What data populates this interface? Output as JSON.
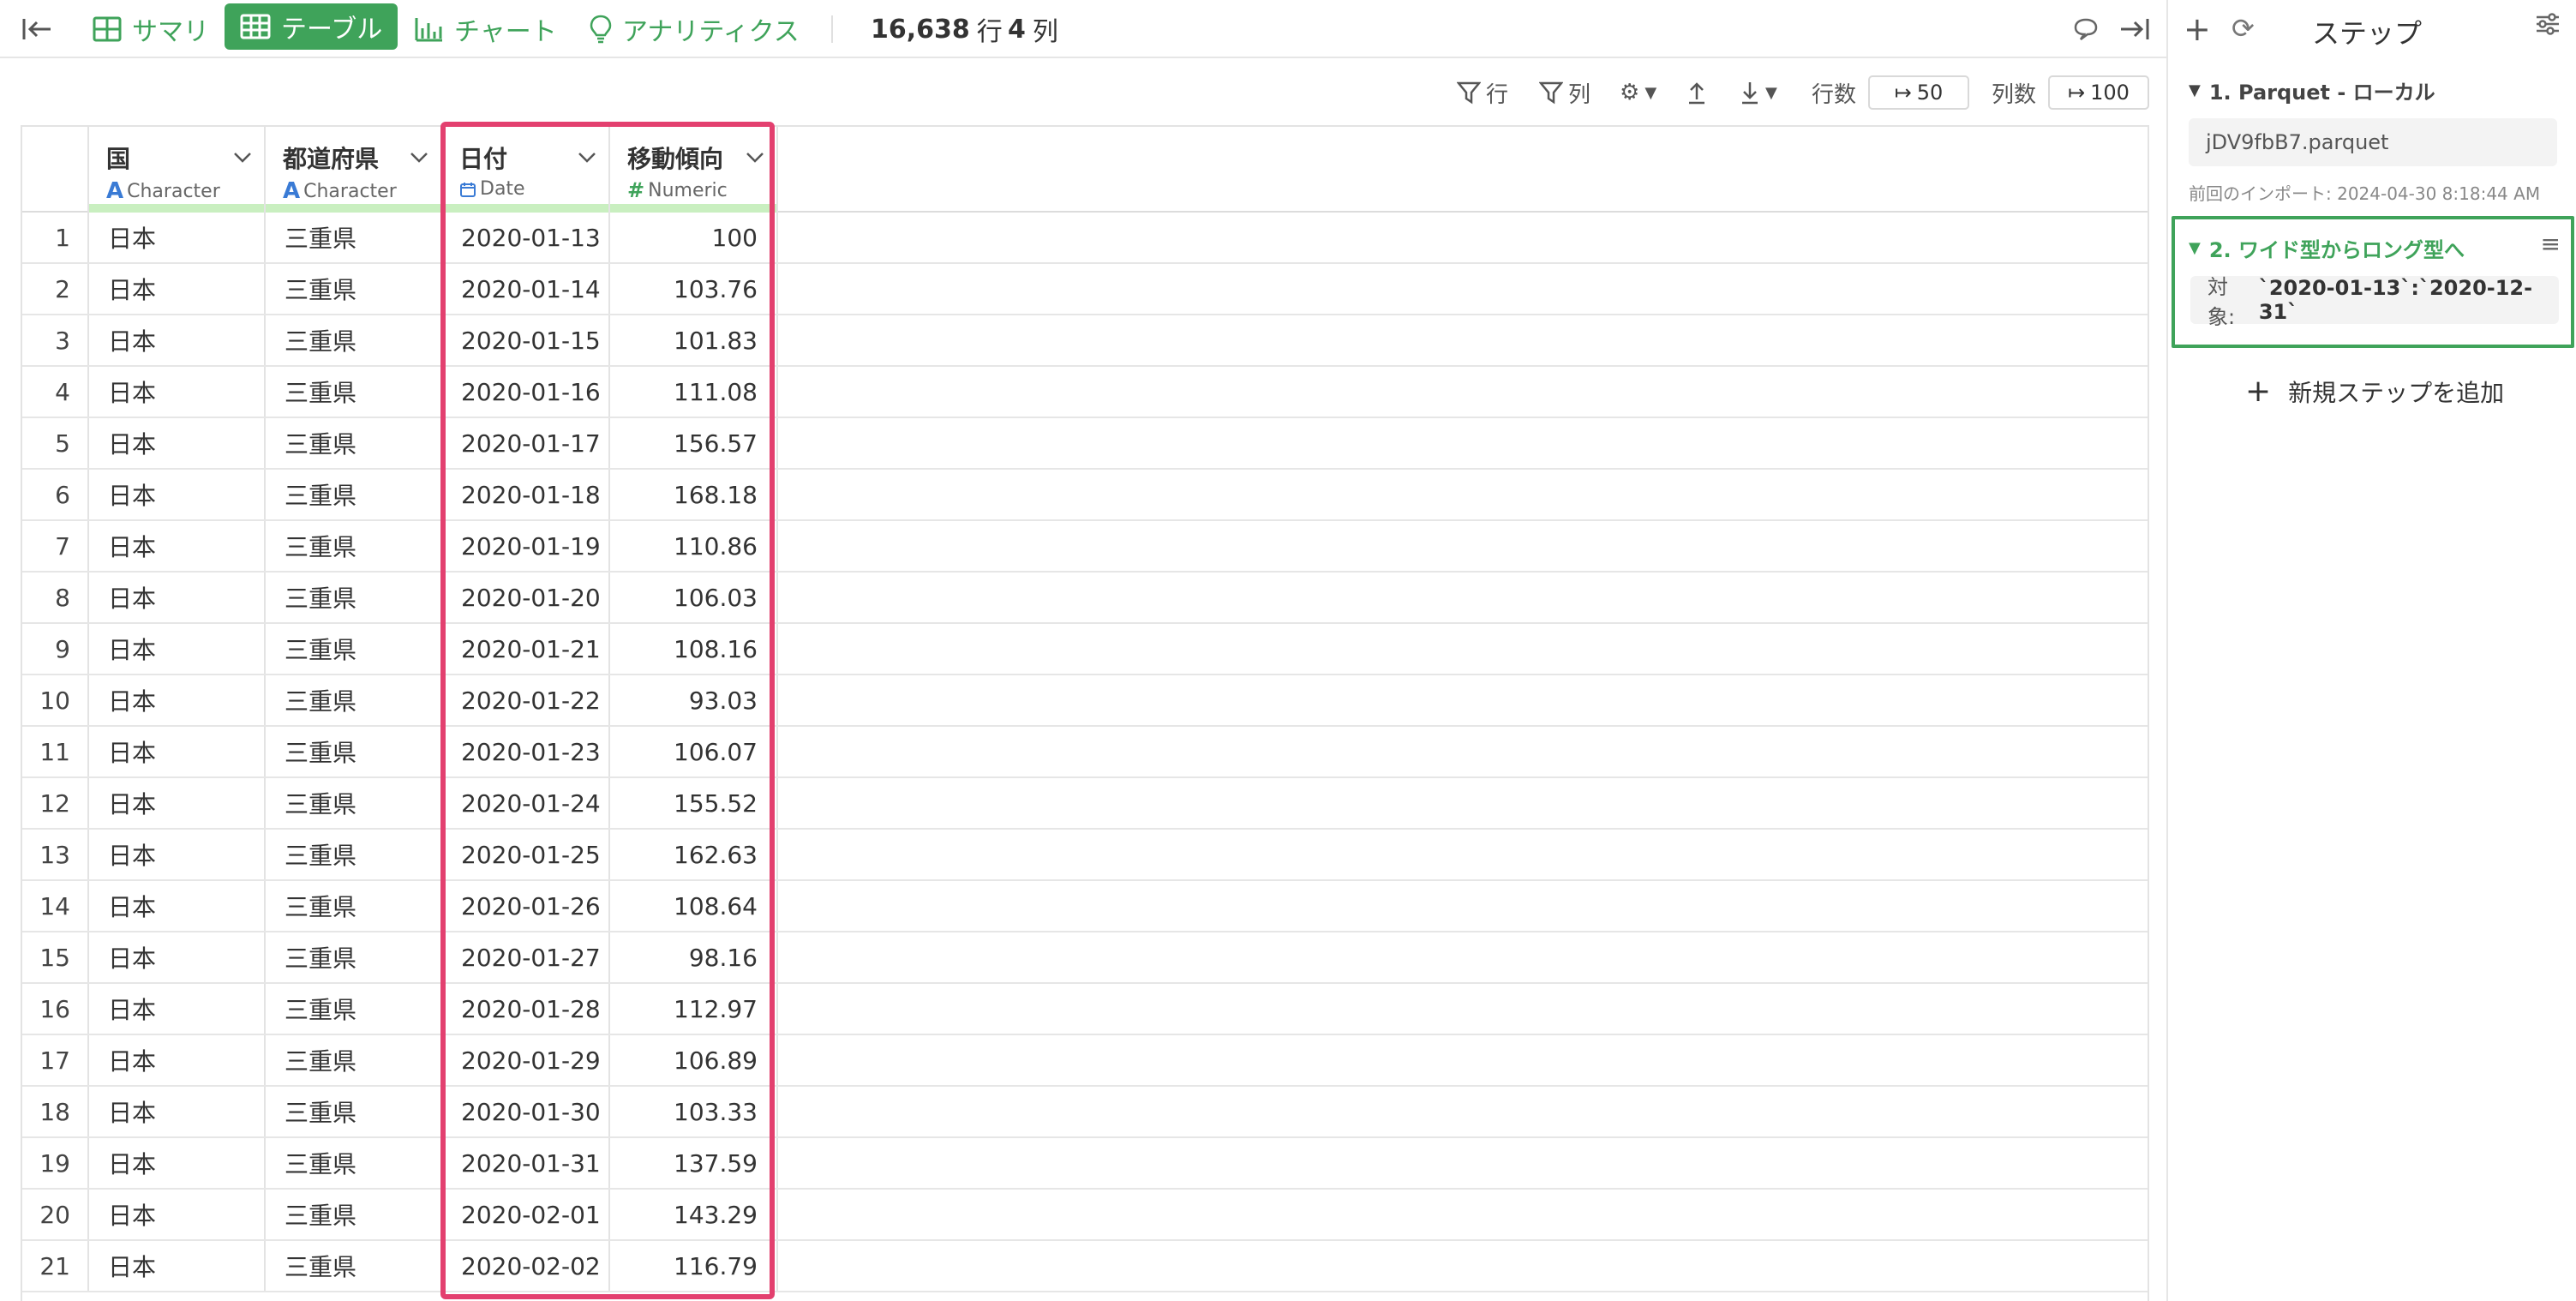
{
  "topbar": {
    "tabs": [
      "サマリ",
      "テーブル",
      "チャート",
      "アナリティクス"
    ],
    "row_count": "16,638",
    "row_unit": "行",
    "col_count": "4",
    "col_unit": "列"
  },
  "toolbar": {
    "row_filter": "行",
    "col_filter": "列",
    "rows_label": "行数",
    "rows_value": "50",
    "cols_label": "列数",
    "cols_value": "100"
  },
  "table": {
    "columns": [
      {
        "name": "国",
        "type": "Character"
      },
      {
        "name": "都道府県",
        "type": "Character"
      },
      {
        "name": "日付",
        "type": "Date"
      },
      {
        "name": "移動傾向",
        "type": "Numeric"
      }
    ],
    "rows": [
      [
        "1",
        "日本",
        "三重県",
        "2020-01-13",
        "100"
      ],
      [
        "2",
        "日本",
        "三重県",
        "2020-01-14",
        "103.76"
      ],
      [
        "3",
        "日本",
        "三重県",
        "2020-01-15",
        "101.83"
      ],
      [
        "4",
        "日本",
        "三重県",
        "2020-01-16",
        "111.08"
      ],
      [
        "5",
        "日本",
        "三重県",
        "2020-01-17",
        "156.57"
      ],
      [
        "6",
        "日本",
        "三重県",
        "2020-01-18",
        "168.18"
      ],
      [
        "7",
        "日本",
        "三重県",
        "2020-01-19",
        "110.86"
      ],
      [
        "8",
        "日本",
        "三重県",
        "2020-01-20",
        "106.03"
      ],
      [
        "9",
        "日本",
        "三重県",
        "2020-01-21",
        "108.16"
      ],
      [
        "10",
        "日本",
        "三重県",
        "2020-01-22",
        "93.03"
      ],
      [
        "11",
        "日本",
        "三重県",
        "2020-01-23",
        "106.07"
      ],
      [
        "12",
        "日本",
        "三重県",
        "2020-01-24",
        "155.52"
      ],
      [
        "13",
        "日本",
        "三重県",
        "2020-01-25",
        "162.63"
      ],
      [
        "14",
        "日本",
        "三重県",
        "2020-01-26",
        "108.64"
      ],
      [
        "15",
        "日本",
        "三重県",
        "2020-01-27",
        "98.16"
      ],
      [
        "16",
        "日本",
        "三重県",
        "2020-01-28",
        "112.97"
      ],
      [
        "17",
        "日本",
        "三重県",
        "2020-01-29",
        "106.89"
      ],
      [
        "18",
        "日本",
        "三重県",
        "2020-01-30",
        "103.33"
      ],
      [
        "19",
        "日本",
        "三重県",
        "2020-01-31",
        "137.59"
      ],
      [
        "20",
        "日本",
        "三重県",
        "2020-02-01",
        "143.29"
      ],
      [
        "21",
        "日本",
        "三重県",
        "2020-02-02",
        "116.79"
      ]
    ]
  },
  "panel": {
    "title": "ステップ",
    "step1_title": "1. Parquet - ローカル",
    "step1_file": "jDV9fbB7.parquet",
    "step1_note": "前回のインポート: 2024-04-30 8:18:44 AM",
    "step2_title": "2. ワイド型からロング型へ",
    "step2_target_label": "対象:",
    "step2_target_value": "`2020-01-13`:`2020-12-31`",
    "add_step": "新規ステップを追加"
  },
  "colors": {
    "accent": "#3fa35a",
    "highlight": "#e3406f",
    "type_bar": "#c9efc0"
  }
}
